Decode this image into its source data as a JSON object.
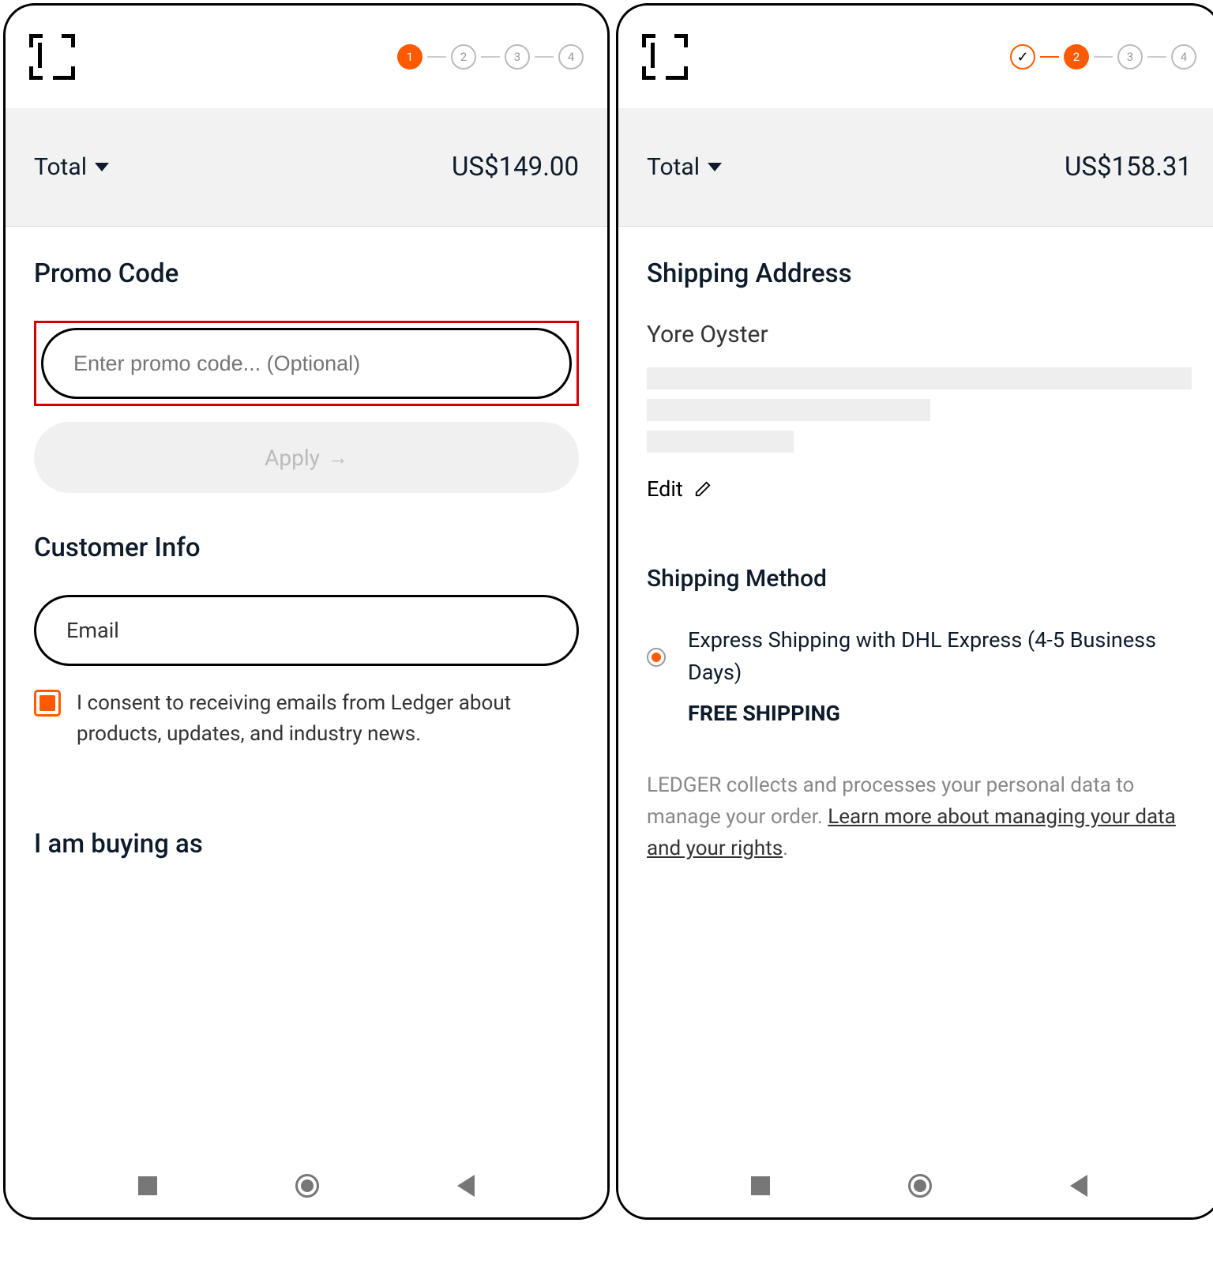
{
  "left": {
    "steps": [
      "1",
      "2",
      "3",
      "4"
    ],
    "active_step": 0,
    "total_label": "Total",
    "total_value": "US$149.00",
    "promo_title": "Promo Code",
    "promo_placeholder": "Enter promo code... (Optional)",
    "apply_label": "Apply",
    "customer_title": "Customer Info",
    "email_label": "Email",
    "consent_text": "I consent to receiving emails from Ledger about products, updates, and industry news.",
    "buying_title": "I am buying as"
  },
  "right": {
    "steps": [
      "✓",
      "2",
      "3",
      "4"
    ],
    "active_step": 1,
    "total_label": "Total",
    "total_value": "US$158.31",
    "address_title": "Shipping Address",
    "name": "Yore Oyster",
    "edit_label": "Edit",
    "method_title": "Shipping Method",
    "method_name": "Express Shipping with DHL Express (4-5 Business Days)",
    "free_label": "FREE SHIPPING",
    "disclaimer_a": "LEDGER collects and processes your personal data to manage your order. ",
    "disclaimer_link": "Learn more about managing your data and your rights",
    "disclaimer_b": "."
  }
}
